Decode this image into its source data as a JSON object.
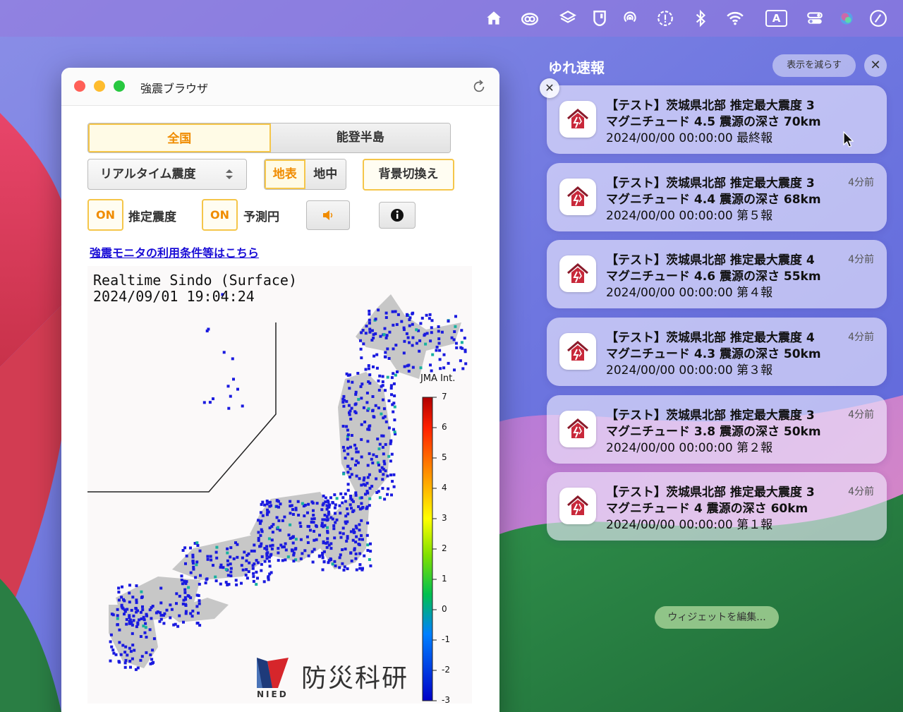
{
  "menubar": {
    "icons": [
      "home-icon",
      "creative-cloud-icon",
      "layers-icon",
      "shield-icon",
      "airdrop-icon",
      "alert-icon",
      "bluetooth-icon",
      "wifi-icon",
      "input-source-icon",
      "control-center-icon",
      "siri-icon",
      "clock-icon"
    ],
    "input_source": "A"
  },
  "window": {
    "title": "強震ブラウザ",
    "region_tabs": [
      "全国",
      "能登半島"
    ],
    "active_region": "全国",
    "mode_select": "リアルタイム震度",
    "surface_toggle": [
      "地表",
      "地中"
    ],
    "active_surface": "地表",
    "background_button": "背景切換え",
    "est_intensity": {
      "state": "ON",
      "label": "推定震度"
    },
    "predict_circle": {
      "state": "ON",
      "label": "予測円"
    },
    "sound_icon": "speaker-icon",
    "info_icon": "info-icon",
    "terms_link": "強震モニタの利用条件等はこちら",
    "map": {
      "title_line1": "Realtime Sindo (Surface)",
      "title_line2": "2024/09/01 19:04:24",
      "scale_title": "JMA Int.",
      "scale_ticks": [
        "7",
        "6",
        "5",
        "4",
        "3",
        "2",
        "1",
        "0",
        "-1",
        "-2",
        "-3"
      ],
      "logo_text": "防災科研",
      "logo_small": "NIED"
    }
  },
  "notification_center": {
    "title": "ゆれ速報",
    "show_less": "表示を減らす",
    "close": "✕",
    "dismiss": "✕",
    "edit_widgets": "ウィジェットを編集...",
    "notifications": [
      {
        "line1": "【テスト】茨城県北部 推定最大震度 3",
        "line2": "マグニチュード 4.5 震源の深さ 70km",
        "line3": "2024/00/00 00:00:00 最終報",
        "time": ""
      },
      {
        "line1": "【テスト】茨城県北部 推定最大震度 3",
        "line2": "マグニチュード 4.4 震源の深さ 68km",
        "line3": "2024/00/00 00:00:00 第５報",
        "time": "4分前"
      },
      {
        "line1": "【テスト】茨城県北部 推定最大震度 4",
        "line2": "マグニチュード 4.6 震源の深さ 55km",
        "line3": "2024/00/00 00:00:00 第４報",
        "time": "4分前"
      },
      {
        "line1": "【テスト】茨城県北部 推定最大震度 4",
        "line2": "マグニチュード 4.3 震源の深さ 50km",
        "line3": "2024/00/00 00:00:00 第３報",
        "time": "4分前"
      },
      {
        "line1": "【テスト】茨城県北部 推定最大震度 3",
        "line2": "マグニチュード 3.8 震源の深さ 50km",
        "line3": "2024/00/00 00:00:00 第２報",
        "time": "4分前"
      },
      {
        "line1": "【テスト】茨城県北部 推定最大震度 3",
        "line2": "マグニチュード 4 震源の深さ 60km",
        "line3": "2024/00/00 00:00:00 第１報",
        "time": "4分前"
      }
    ]
  },
  "colors": {
    "accent_orange": "#f08c00",
    "accent_border": "#f5c64a",
    "link": "#1a0dd6",
    "station_dot": "#1a1adf"
  }
}
